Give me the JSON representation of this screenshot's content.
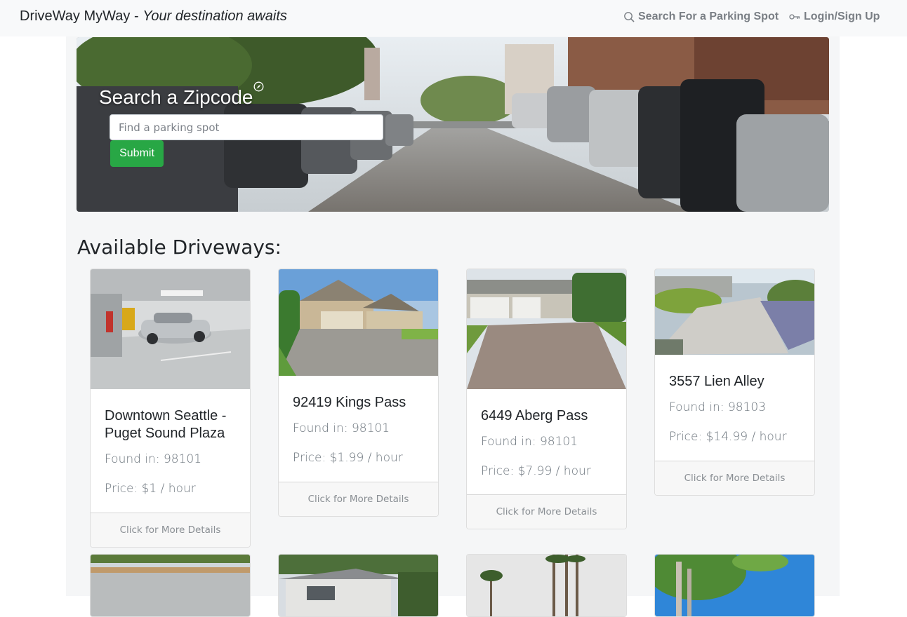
{
  "navbar": {
    "brand_name": "DriveWay MyWay -",
    "brand_tagline": "Your destination awaits",
    "search_link": "Search For a Parking Spot",
    "login_link": "Login/Sign Up"
  },
  "hero": {
    "title": "Search a Zipcode",
    "input_placeholder": "Find a parking spot",
    "submit_label": "Submit"
  },
  "section_title": "Available Driveways:",
  "driveways": [
    {
      "title": "Downtown Seattle - Puget Sound Plaza",
      "found": "Found in: 98101",
      "price": "Price: $1 / hour",
      "footer": "Click for More Details"
    },
    {
      "title": "92419 Kings Pass",
      "found": "Found in: 98101",
      "price": "Price: $1.99 / hour",
      "footer": "Click for More Details"
    },
    {
      "title": "6449 Aberg Pass",
      "found": "Found in: 98101",
      "price": "Price: $7.99 / hour",
      "footer": "Click for More Details"
    },
    {
      "title": "3557 Lien Alley",
      "found": "Found in: 98103",
      "price": "Price: $14.99 / hour",
      "footer": "Click for More Details"
    }
  ],
  "colors": {
    "submit_green": "#28a745",
    "navbar_bg": "#f8f9fa",
    "nav_link_gray": "#7a7f85"
  }
}
